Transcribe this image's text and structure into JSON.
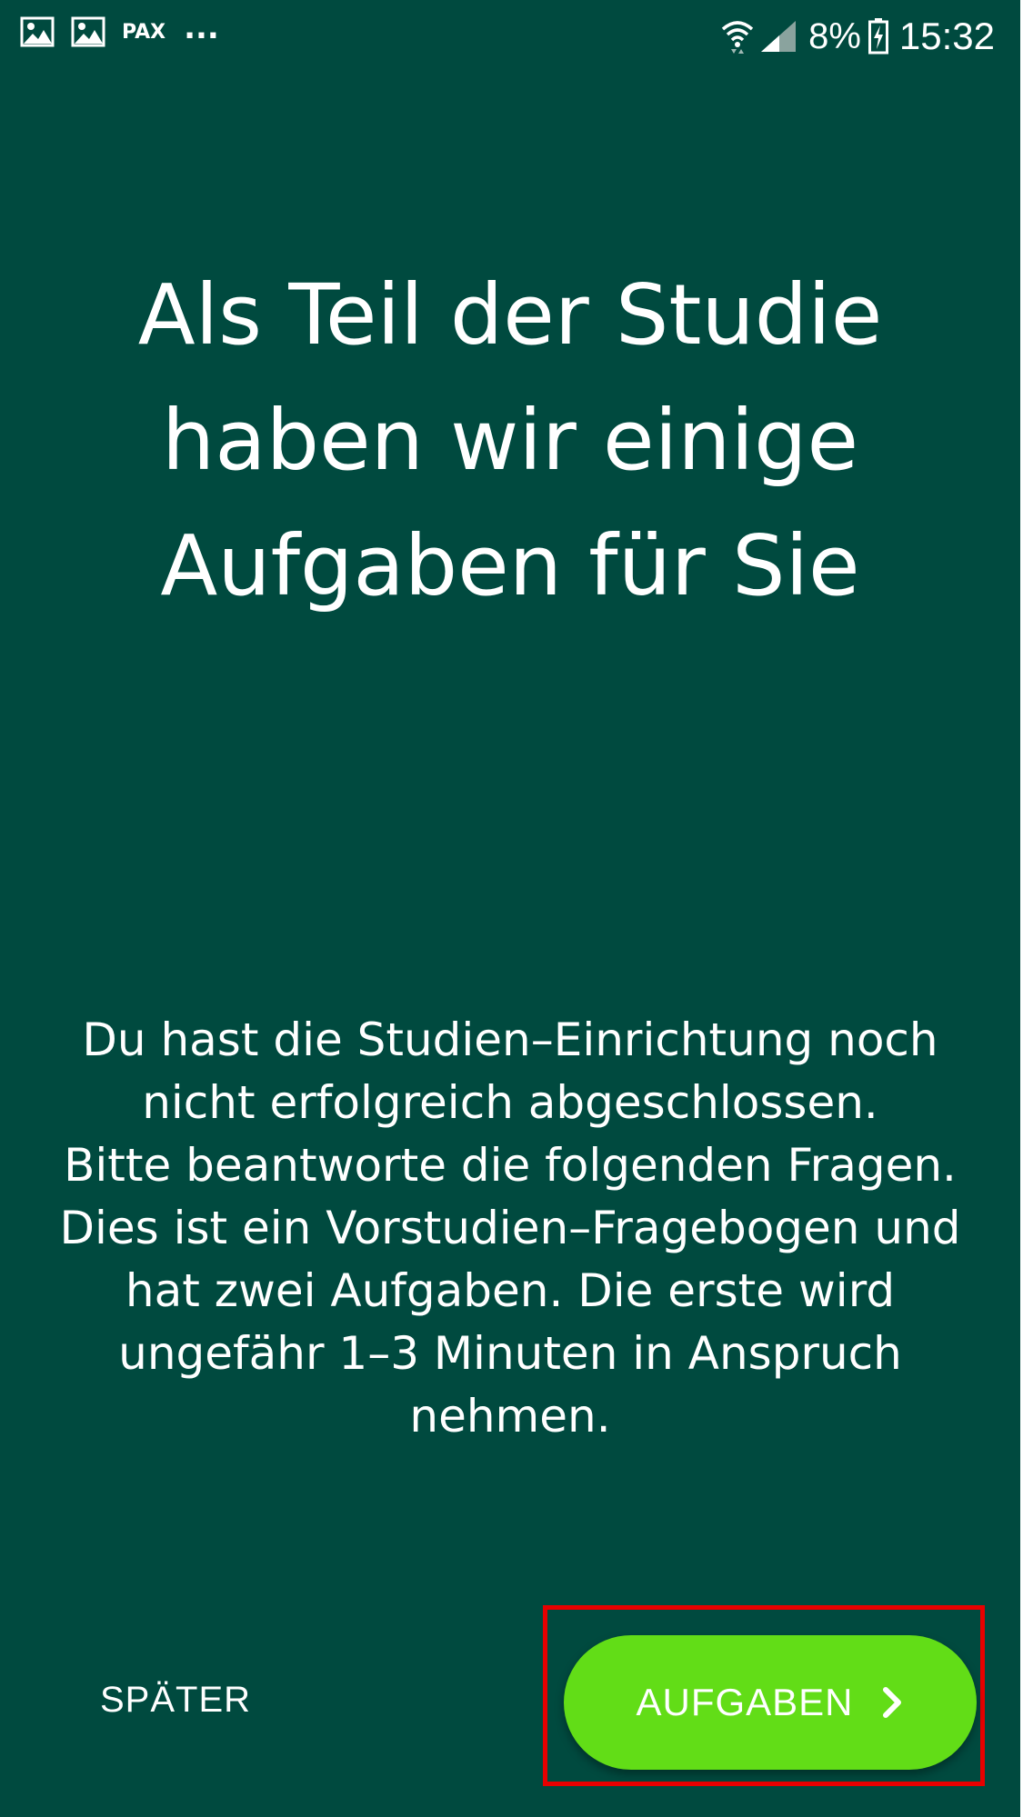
{
  "status_bar": {
    "notification_icons": [
      "image-icon",
      "image-icon"
    ],
    "pax_label": "PAX",
    "more_label": "...",
    "battery_percent": "8%",
    "time": "15:32"
  },
  "headline": "Als Teil der Studie haben wir einige Aufgaben für Sie",
  "body": {
    "paragraph1": "Du hast die Studien–Einrichtung noch nicht erfolgreich abgeschlossen.",
    "paragraph2": "Bitte beantworte die folgenden Fragen. Dies ist ein Vorstudien–Fragebogen und hat zwei Aufgaben. Die erste wird ungefähr 1–3 Minuten in Anspruch nehmen."
  },
  "actions": {
    "later_label": "SPÄTER",
    "tasks_label": "AUFGABEN"
  },
  "colors": {
    "background": "#004a3f",
    "primary_button": "#62dd17",
    "highlight": "#e80000",
    "text": "#ffffff"
  }
}
